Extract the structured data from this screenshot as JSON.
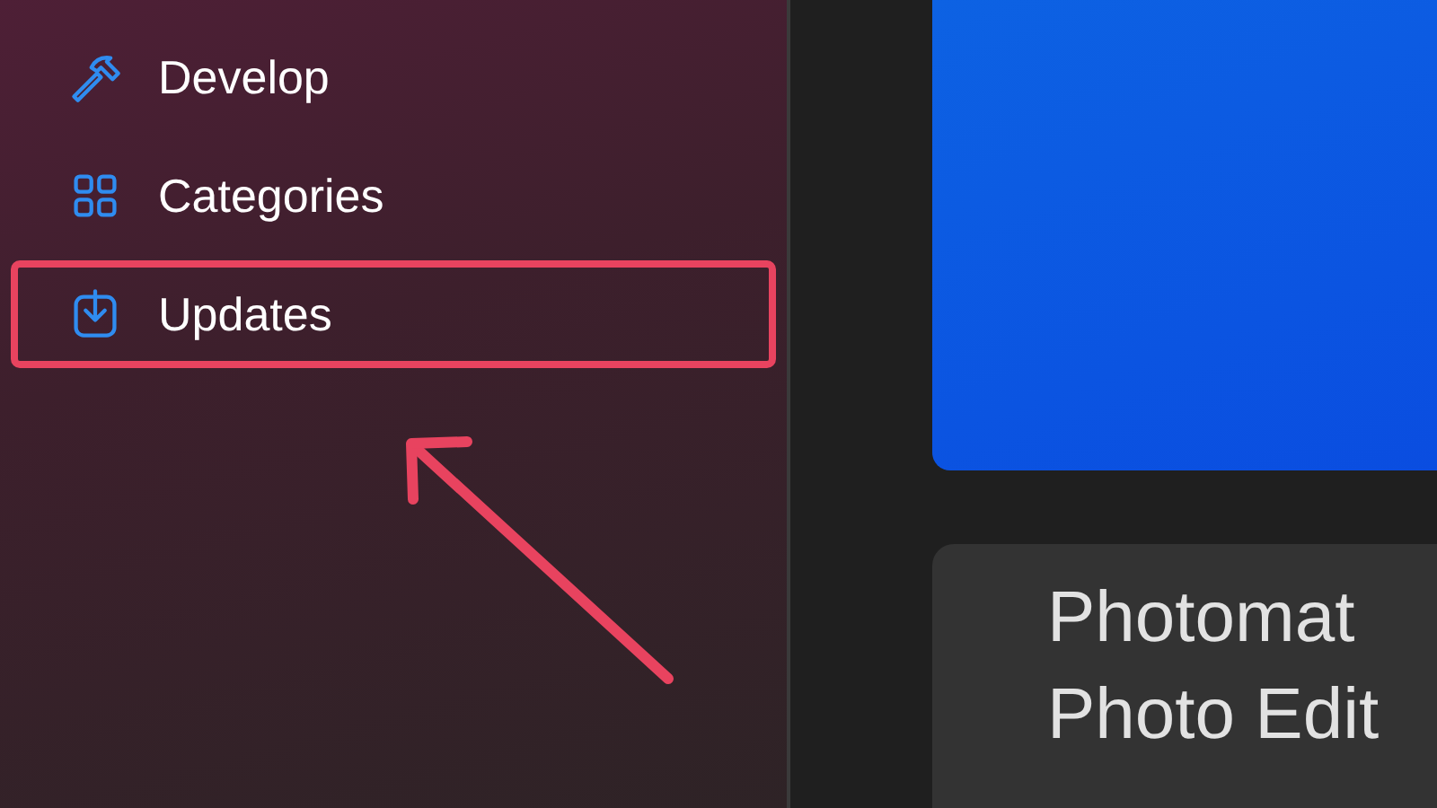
{
  "sidebar": {
    "items": [
      {
        "label": "Develop",
        "highlighted": false
      },
      {
        "label": "Categories",
        "highlighted": false
      },
      {
        "label": "Updates",
        "highlighted": true
      }
    ]
  },
  "content": {
    "app_card": {
      "title_lines": [
        "Photomat",
        "Photo Edit"
      ]
    }
  }
}
